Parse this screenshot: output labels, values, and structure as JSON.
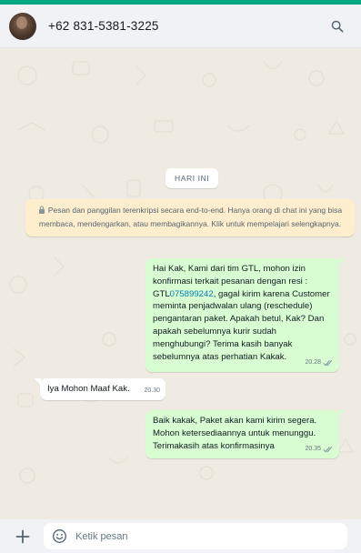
{
  "header": {
    "contact_name": "+62 831-5381-3225",
    "search_icon": "search-icon",
    "avatar": "contact-avatar"
  },
  "chat": {
    "date_chip": "HARI INI",
    "encryption_notice": "Pesan dan panggilan terenkripsi secara end-to-end. Hanya orang di chat ini yang bisa membaca, mendengarkan, atau membagikannya. Klik untuk mempelajari selengkapnya.",
    "messages": [
      {
        "direction": "outgoing",
        "text_before_link": "Hai Kak, Kami dari tim GTL, mohon izin konfirmasi terkait pesanan dengan resi : GTL",
        "link": "075899242",
        "text_after_link": ", gagal kirim karena Customer meminta penjadwalan ulang (reschedule) pengantaran paket. Apakah betul, Kak? Dan apakah sebelumnya kurir sudah menghubungi? Terima kasih banyak sebelumnya atas perhatian Kakak.",
        "time": "20.28",
        "status": "read"
      },
      {
        "direction": "incoming",
        "text": "Iya Mohon Maaf Kak.",
        "time": "20.30"
      },
      {
        "direction": "outgoing",
        "text": "Baik kakak, Paket akan kami kirim segera.\nMohon ketersediaannya untuk menunggu.\nTerimakasih atas konfirmasinya",
        "time": "20.35",
        "status": "read"
      }
    ]
  },
  "composer": {
    "placeholder": "Ketik pesan",
    "attach_icon": "plus-icon",
    "emoji_icon": "emoji-icon"
  },
  "colors": {
    "accent": "#00a884",
    "outgoing_bubble": "#d9fdd3",
    "incoming_bubble": "#ffffff",
    "system_notice": "#ffeecd",
    "chat_background": "#efeae2",
    "link": "#027eb5"
  }
}
